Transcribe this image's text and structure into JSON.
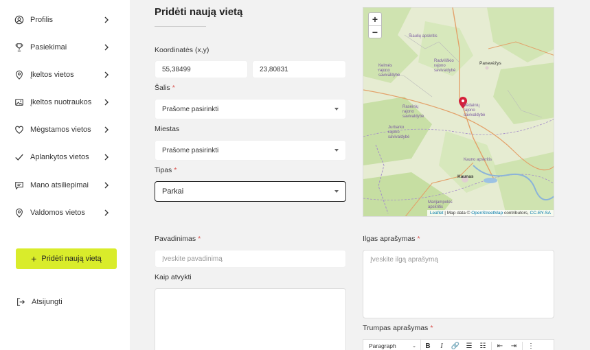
{
  "sidebar": {
    "items": [
      {
        "label": "Profilis",
        "icon": "user-circle-icon"
      },
      {
        "label": "Pasiekimai",
        "icon": "trophy-icon"
      },
      {
        "label": "Įkeltos vietos",
        "icon": "map-pin-icon"
      },
      {
        "label": "Įkeltos nuotraukos",
        "icon": "image-icon"
      },
      {
        "label": "Mėgstamos vietos",
        "icon": "heart-icon"
      },
      {
        "label": "Aplankytos vietos",
        "icon": "check-icon"
      },
      {
        "label": "Mano atsiliepimai",
        "icon": "comment-icon"
      },
      {
        "label": "Valdomos vietos",
        "icon": "map-pin-icon"
      }
    ],
    "add_button": "Pridėti naują vietą",
    "logout": "Atsijungti"
  },
  "form": {
    "title": "Pridėti naują vietą",
    "coords_label": "Koordinatės (x,y)",
    "coord_x": "55,38499",
    "coord_y": "23,80831",
    "country_label": "Šalis",
    "country_value": "Prašome pasirinkti",
    "city_label": "Miestas",
    "city_value": "Prašome pasirinkti",
    "type_label": "Tipas",
    "type_value": "Parkai",
    "name_label": "Pavadinimas",
    "name_placeholder": "Įveskite pavadinimą",
    "directions_label": "Kaip atvykti",
    "long_desc_label": "Ilgas aprašymas",
    "long_desc_placeholder": "Įveskite ilgą aprašymą",
    "short_desc_label": "Trumpas aprašymas",
    "required_mark": "*"
  },
  "map": {
    "zoom_in": "+",
    "zoom_out": "−",
    "attribution_leaflet": "Leaflet",
    "attribution_text": " | Map data © ",
    "attribution_osm": "OpenStreetMap",
    "attribution_contrib": " contributors, ",
    "attribution_license": "CC-BY-SA",
    "labels": {
      "siauliai": "Šiaulių apskritis",
      "kelme": "Kelmės rajono savivaldybė",
      "radviliskis": "Radviliškio rajono savivaldybė",
      "raseiniai": "Raseinių rajono savivaldybė",
      "kedainiai": "Kėdainių rajono savivaldybė",
      "jurbarkas": "Jurbarko rajono savivaldybė",
      "kauno_aps": "Kauno apskritis",
      "marijampole": "Marijampolės apskritis"
    },
    "cities": {
      "panevezys": "Panevėžys",
      "kaunas": "Kaunas"
    }
  },
  "editor": {
    "paragraph": "Paragraph",
    "bold": "B",
    "italic": "I"
  },
  "colors": {
    "accent": "#d9ec2b",
    "marker": "#d4203a"
  }
}
